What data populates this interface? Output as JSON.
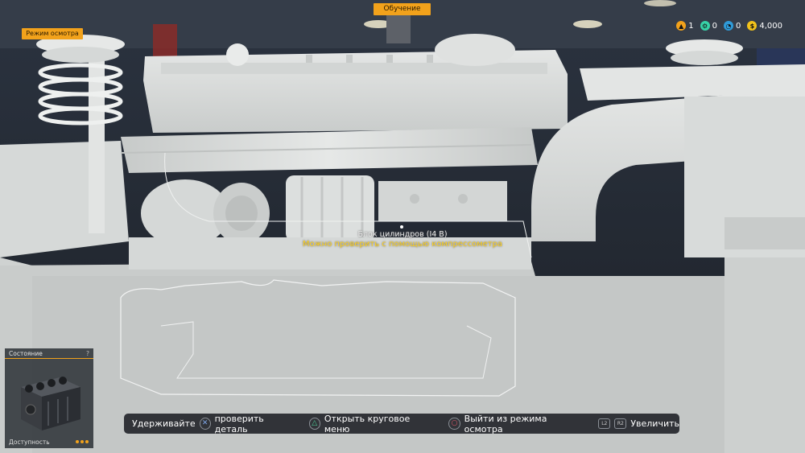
{
  "top_tab": {
    "label": "Обучение"
  },
  "mode_badge": {
    "label": "Режим осмотра"
  },
  "hud": {
    "items": [
      {
        "icon": "level-icon",
        "value": "1",
        "color": "#f2a21b"
      },
      {
        "icon": "parts-icon",
        "value": "0",
        "color": "#37d3a8"
      },
      {
        "icon": "skill-points-icon",
        "value": "0",
        "color": "#2f9bd9"
      },
      {
        "icon": "money-icon",
        "value": "4,000",
        "color": "#f2c21b"
      }
    ]
  },
  "part": {
    "name": "Блок цилиндров (I4 B)",
    "hint": "Можно проверить с помощью компрессометра"
  },
  "status_panel": {
    "title": "Состояние",
    "help": "?",
    "availability_label": "Доступность"
  },
  "controls": [
    {
      "icon": "cross-button-icon",
      "glyph": "✕",
      "pre": "Удерживайте",
      "label": "проверить деталь"
    },
    {
      "icon": "triangle-button-icon",
      "glyph": "△",
      "label": "Открыть круговое меню"
    },
    {
      "icon": "circle-button-icon",
      "glyph": "○",
      "label": "Выйти из режима осмотра"
    },
    {
      "icon": "trigger-buttons-icon",
      "glyph_l": "L2",
      "glyph_r": "R2",
      "label": "Увеличить"
    }
  ],
  "colors": {
    "accent": "#f2a21b",
    "hint_text": "#ffd21f",
    "ghost_part": "#d9dcdc"
  }
}
